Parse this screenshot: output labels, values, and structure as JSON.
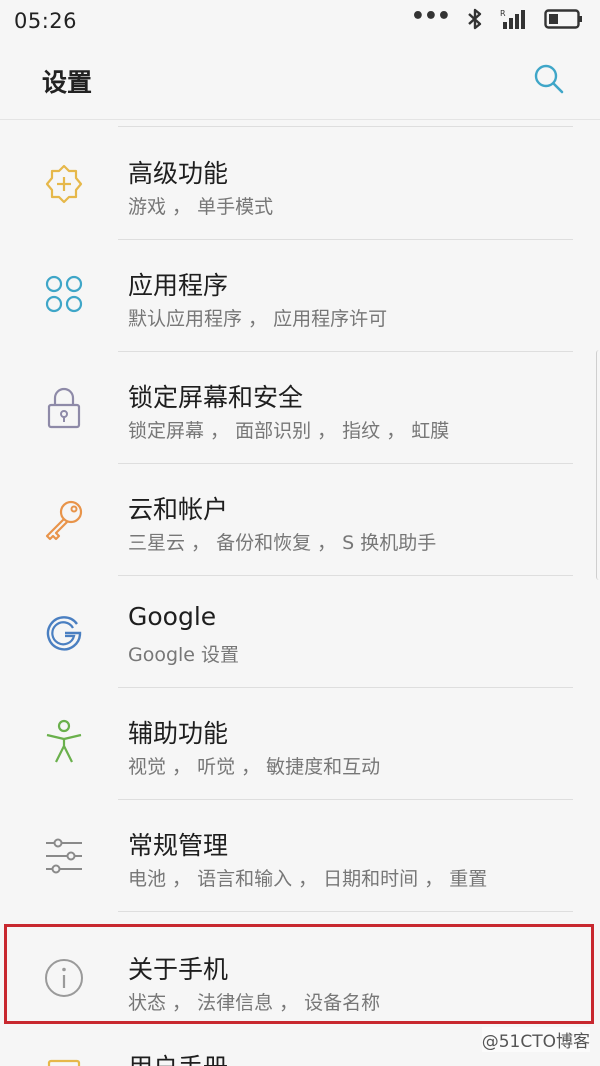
{
  "status_bar": {
    "time": "05:26",
    "more_dots": "•••",
    "icons": [
      "bluetooth-icon",
      "signal-icon",
      "battery-icon"
    ]
  },
  "app_bar": {
    "title": "设置",
    "search_icon": "search-icon"
  },
  "items": [
    {
      "title": "高级功能",
      "subtitle": "游戏 ， 单手模式",
      "icon": "advanced-features-icon",
      "icon_color": "#e6b84a"
    },
    {
      "title": "应用程序",
      "subtitle": "默认应用程序 ， 应用程序许可",
      "icon": "apps-icon",
      "icon_color": "#3fa6c8"
    },
    {
      "title": "锁定屏幕和安全",
      "subtitle": "锁定屏幕 ， 面部识别 ， 指纹 ， 虹膜",
      "icon": "lock-icon",
      "icon_color": "#8e8aa8"
    },
    {
      "title": "云和帐户",
      "subtitle": "三星云 ， 备份和恢复 ， S 换机助手",
      "icon": "key-icon",
      "icon_color": "#e8944a"
    },
    {
      "title": "Google",
      "subtitle": "Google 设置",
      "icon": "google-icon",
      "icon_color": "#4a7fc1"
    },
    {
      "title": "辅助功能",
      "subtitle": "视觉 ， 听觉 ， 敏捷度和互动",
      "icon": "accessibility-icon",
      "icon_color": "#6ab04c"
    },
    {
      "title": "常规管理",
      "subtitle": "电池 ， 语言和输入 ， 日期和时间 ， 重置",
      "icon": "sliders-icon",
      "icon_color": "#8a8a8a"
    },
    {
      "title": "关于手机",
      "subtitle": "状态 ， 法律信息 ， 设备名称",
      "icon": "info-icon",
      "icon_color": "#9a9a9a"
    },
    {
      "title": "用户手册",
      "subtitle": "",
      "icon": "manual-icon",
      "icon_color": "#e6b84a"
    }
  ],
  "watermark": "@51CTO博客",
  "highlight_color": "#c8282f"
}
